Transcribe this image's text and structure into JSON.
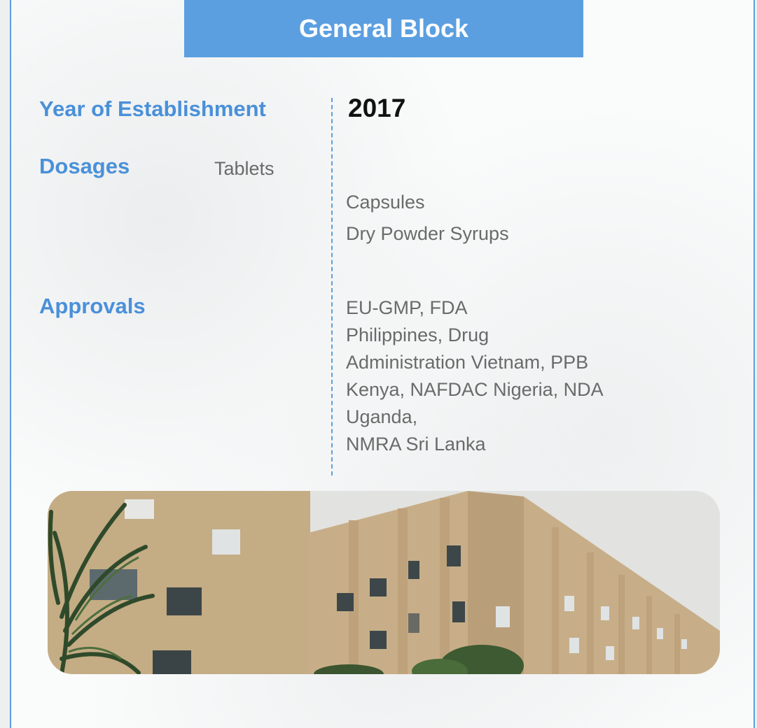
{
  "header": {
    "title": "General Block"
  },
  "establishment": {
    "label": "Year of Establishment",
    "value": "2017"
  },
  "dosages": {
    "label": "Dosages",
    "items": [
      "Tablets",
      "Capsules",
      "Dry Powder Syrups"
    ]
  },
  "approvals": {
    "label": "Approvals",
    "lines": [
      "EU-GMP, FDA",
      "Philippines, Drug",
      "Administration Vietnam, PPB",
      "Kenya, NAFDAC Nigeria, NDA",
      "Uganda,",
      "NMRA Sri Lanka"
    ]
  },
  "colors": {
    "accent": "#5b9fe0",
    "label": "#4a90d9",
    "text_gray": "#6a6a6a"
  }
}
